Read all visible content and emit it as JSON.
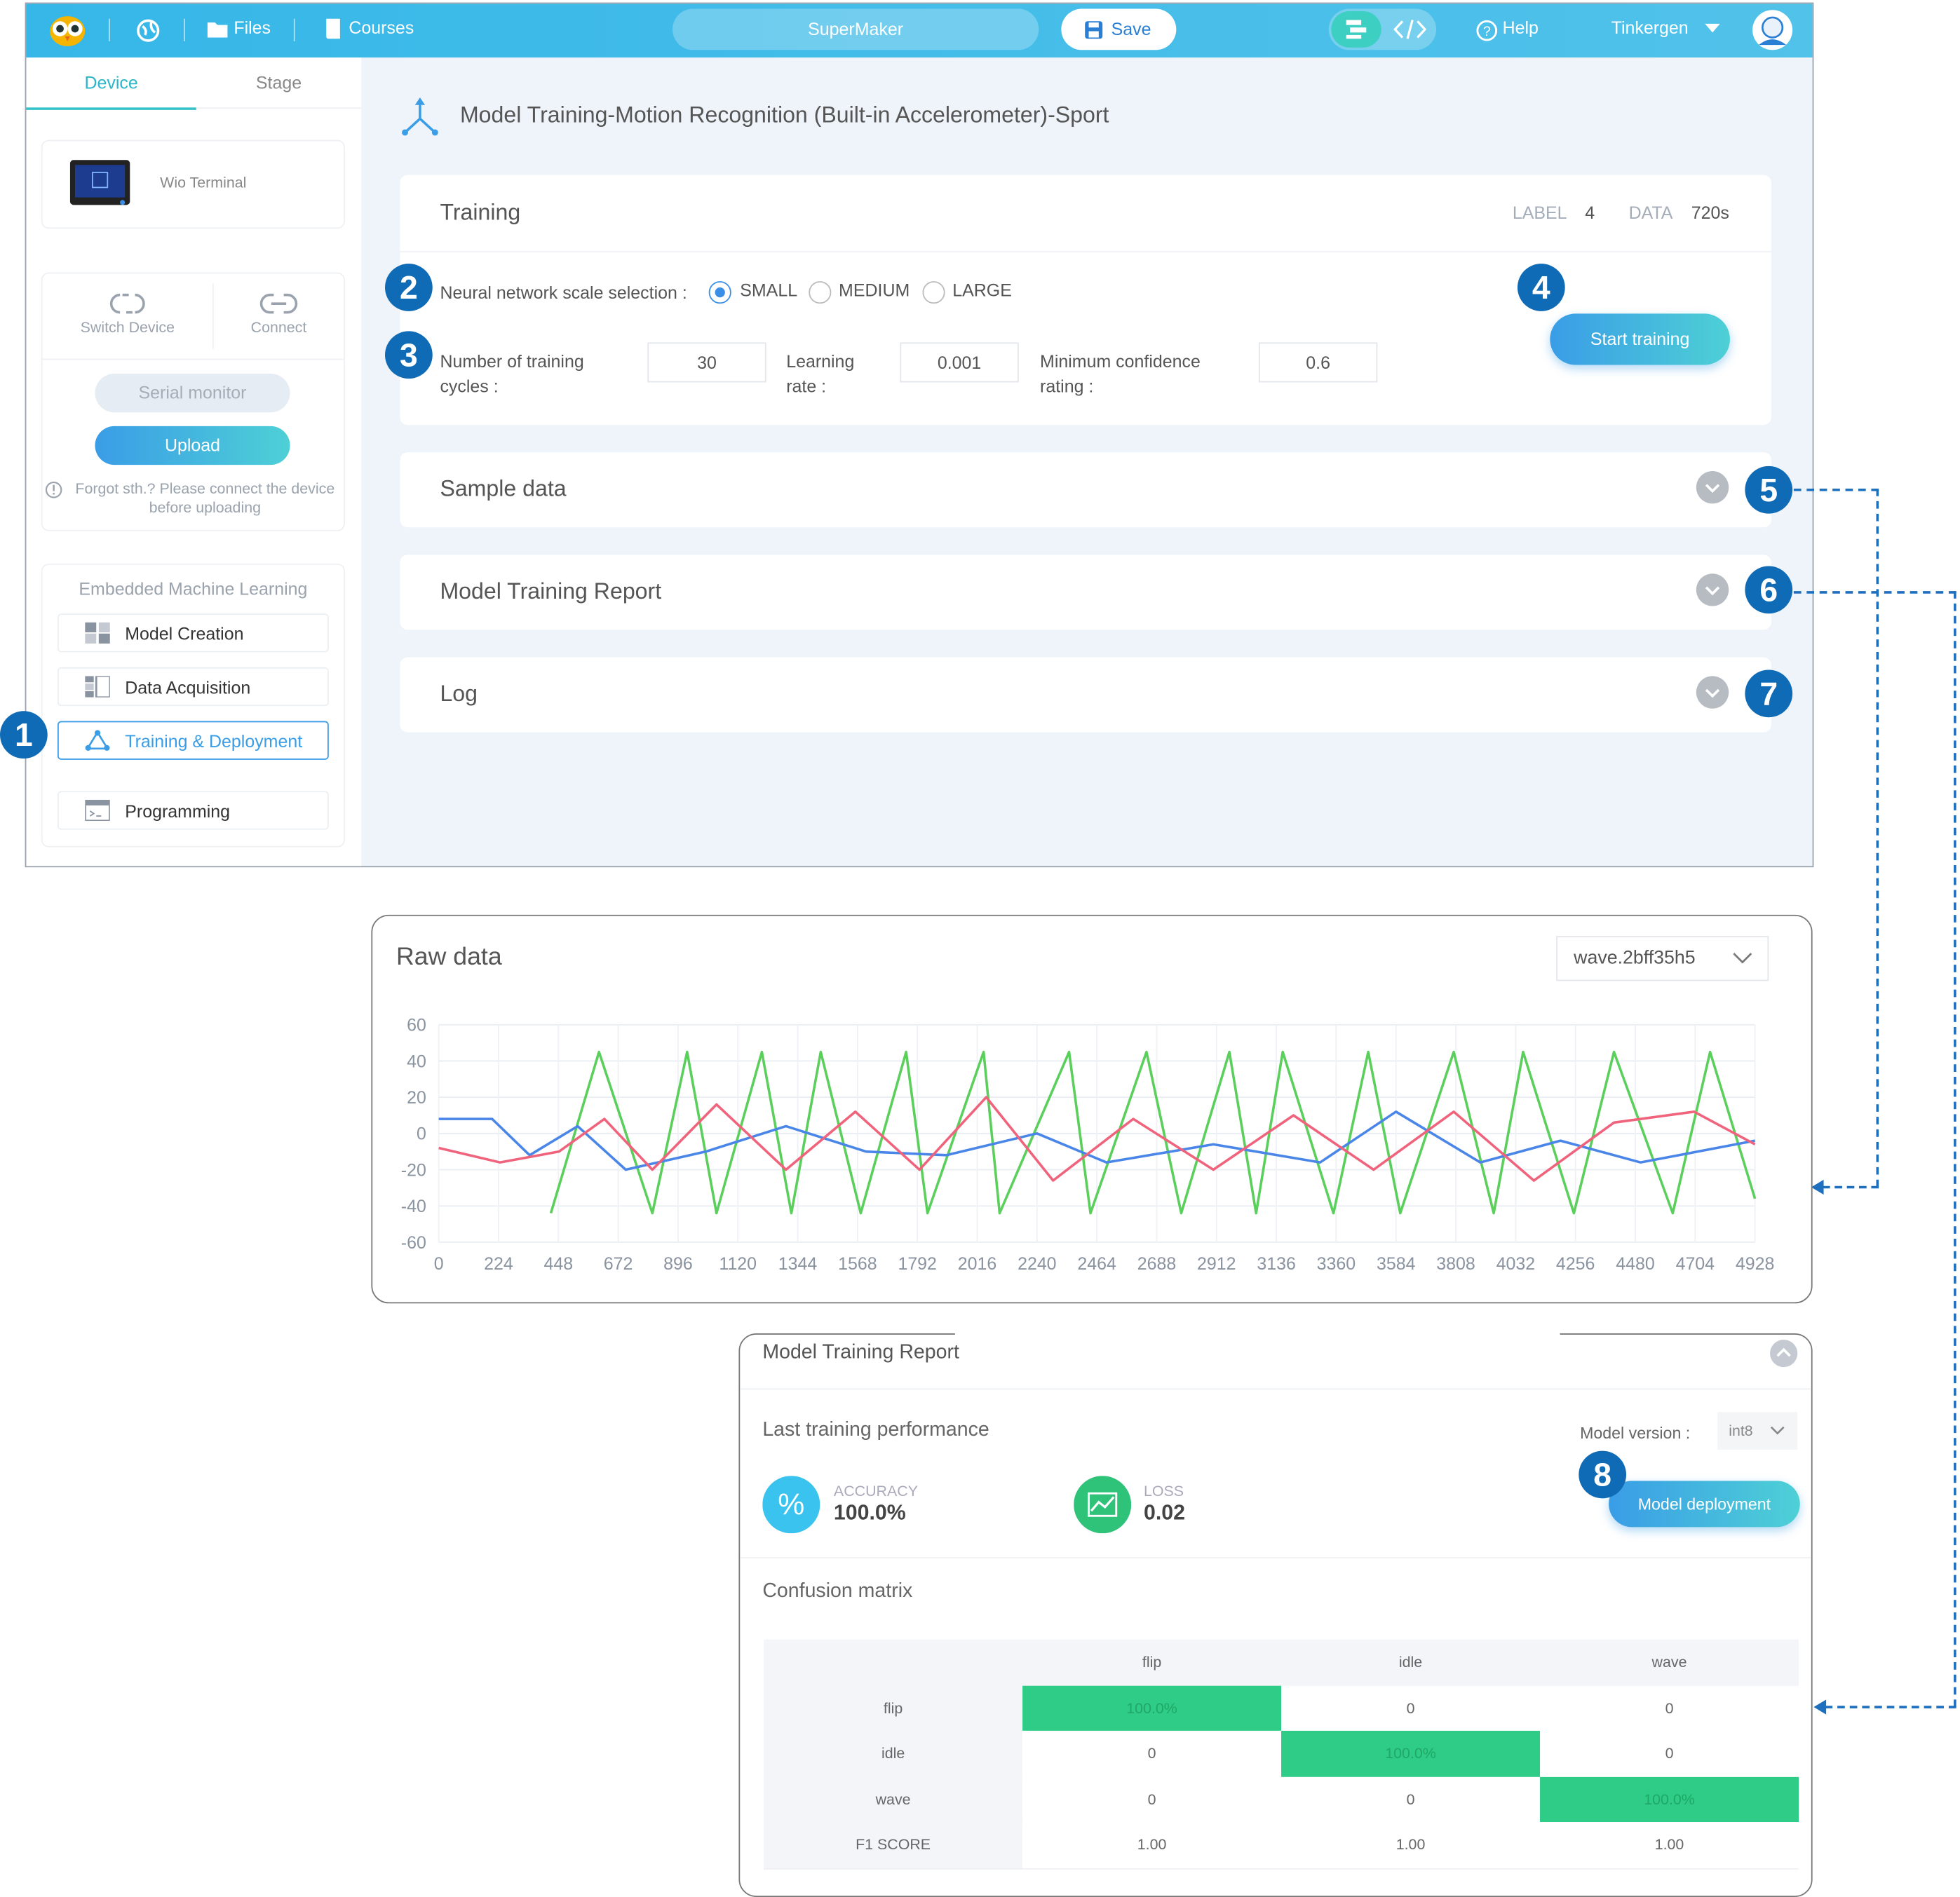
{
  "topbar": {
    "files": "Files",
    "courses": "Courses",
    "project": "SuperMaker",
    "save": "Save",
    "help": "Help",
    "user": "Tinkergen"
  },
  "sidebar": {
    "tabs": [
      "Device",
      "Stage"
    ],
    "device_name": "Wio Terminal",
    "switch_device": "Switch Device",
    "connect": "Connect",
    "serial_monitor": "Serial monitor",
    "upload": "Upload",
    "note": "Forgot sth.? Please connect the device before uploading",
    "section_title": "Embedded Machine Learning",
    "nav": [
      "Model Creation",
      "Data Acquisition",
      "Training & Deployment",
      "Programming"
    ]
  },
  "main": {
    "title": "Model Training-Motion Recognition (Built-in Accelerometer)-Sport",
    "training": {
      "title": "Training",
      "label_key": "LABEL",
      "label_val": "4",
      "data_key": "DATA",
      "data_val": "720s",
      "scale_label": "Neural network scale selection :",
      "scale_options": [
        "SMALL",
        "MEDIUM",
        "LARGE"
      ],
      "scale_selected": "SMALL",
      "cycles_label": "Number of training cycles :",
      "cycles": "30",
      "lr_label": "Learning rate :",
      "lr": "0.001",
      "conf_label": "Minimum confidence rating :",
      "conf": "0.6",
      "start": "Start training"
    },
    "sections": [
      "Sample data",
      "Model Training Report",
      "Log"
    ]
  },
  "badges": [
    "1",
    "2",
    "3",
    "4",
    "5",
    "6",
    "7",
    "8"
  ],
  "raw": {
    "title": "Raw data",
    "select": "wave.2bff35h5"
  },
  "chart_data": {
    "type": "line",
    "x_ticks": [
      0,
      224,
      448,
      672,
      896,
      1120,
      1344,
      1568,
      1792,
      2016,
      2240,
      2464,
      2688,
      2912,
      3136,
      3360,
      3584,
      3808,
      4032,
      4256,
      4480,
      4704,
      4928
    ],
    "y_ticks": [
      60,
      40,
      20,
      0,
      -20,
      -40,
      -60
    ],
    "ylim": [
      -60,
      60
    ],
    "xlim": [
      0,
      4928
    ],
    "series": [
      {
        "color": "#5bcf5b",
        "peaks": [
          [
            420,
            -44
          ],
          [
            600,
            45
          ],
          [
            800,
            -44
          ],
          [
            930,
            45
          ],
          [
            1040,
            -44
          ],
          [
            1210,
            45
          ],
          [
            1320,
            -44
          ],
          [
            1430,
            45
          ],
          [
            1580,
            -44
          ],
          [
            1750,
            45
          ],
          [
            1830,
            -44
          ],
          [
            2040,
            45
          ],
          [
            2100,
            -44
          ],
          [
            2360,
            45
          ],
          [
            2440,
            -44
          ],
          [
            2650,
            45
          ],
          [
            2780,
            -44
          ],
          [
            2960,
            45
          ],
          [
            3060,
            -44
          ],
          [
            3160,
            45
          ],
          [
            3350,
            -44
          ],
          [
            3480,
            45
          ],
          [
            3600,
            -44
          ],
          [
            3800,
            45
          ],
          [
            3950,
            -44
          ],
          [
            4060,
            45
          ],
          [
            4250,
            -44
          ],
          [
            4400,
            45
          ],
          [
            4620,
            -44
          ],
          [
            4760,
            45
          ],
          [
            4928,
            -36
          ]
        ]
      },
      {
        "color": "#4a86e8",
        "peaks": [
          [
            0,
            8
          ],
          [
            200,
            8
          ],
          [
            340,
            -12
          ],
          [
            520,
            4
          ],
          [
            700,
            -20
          ],
          [
            1000,
            -10
          ],
          [
            1300,
            4
          ],
          [
            1600,
            -10
          ],
          [
            1900,
            -12
          ],
          [
            2240,
            0
          ],
          [
            2500,
            -16
          ],
          [
            2900,
            -6
          ],
          [
            3300,
            -16
          ],
          [
            3584,
            12
          ],
          [
            3900,
            -16
          ],
          [
            4200,
            -4
          ],
          [
            4500,
            -16
          ],
          [
            4928,
            -4
          ]
        ]
      },
      {
        "color": "#f0637c",
        "peaks": [
          [
            0,
            -8
          ],
          [
            230,
            -16
          ],
          [
            450,
            -10
          ],
          [
            620,
            8
          ],
          [
            800,
            -20
          ],
          [
            1040,
            16
          ],
          [
            1300,
            -20
          ],
          [
            1560,
            12
          ],
          [
            1800,
            -20
          ],
          [
            2050,
            20
          ],
          [
            2300,
            -26
          ],
          [
            2600,
            8
          ],
          [
            2900,
            -20
          ],
          [
            3200,
            10
          ],
          [
            3500,
            -20
          ],
          [
            3800,
            12
          ],
          [
            4100,
            -26
          ],
          [
            4400,
            6
          ],
          [
            4700,
            12
          ],
          [
            4928,
            -6
          ]
        ]
      }
    ]
  },
  "report": {
    "title": "Model Training Report",
    "last_perf": "Last training performance",
    "model_version_label": "Model version :",
    "model_version": "int8",
    "accuracy_label": "ACCURACY",
    "accuracy": "100.0%",
    "loss_label": "LOSS",
    "loss": "0.02",
    "deploy": "Model deployment",
    "cm_title": "Confusion matrix",
    "cm_headers": [
      "",
      "flip",
      "idle",
      "wave"
    ],
    "cm_rows": [
      [
        "flip",
        "100.0%",
        "0",
        "0"
      ],
      [
        "idle",
        "0",
        "100.0%",
        "0"
      ],
      [
        "wave",
        "0",
        "0",
        "100.0%"
      ],
      [
        "F1 SCORE",
        "1.00",
        "1.00",
        "1.00"
      ]
    ]
  },
  "colors": {
    "accent": "#36b7e8",
    "badge": "#0f6bb5",
    "cm_green": "#2ecc86"
  }
}
